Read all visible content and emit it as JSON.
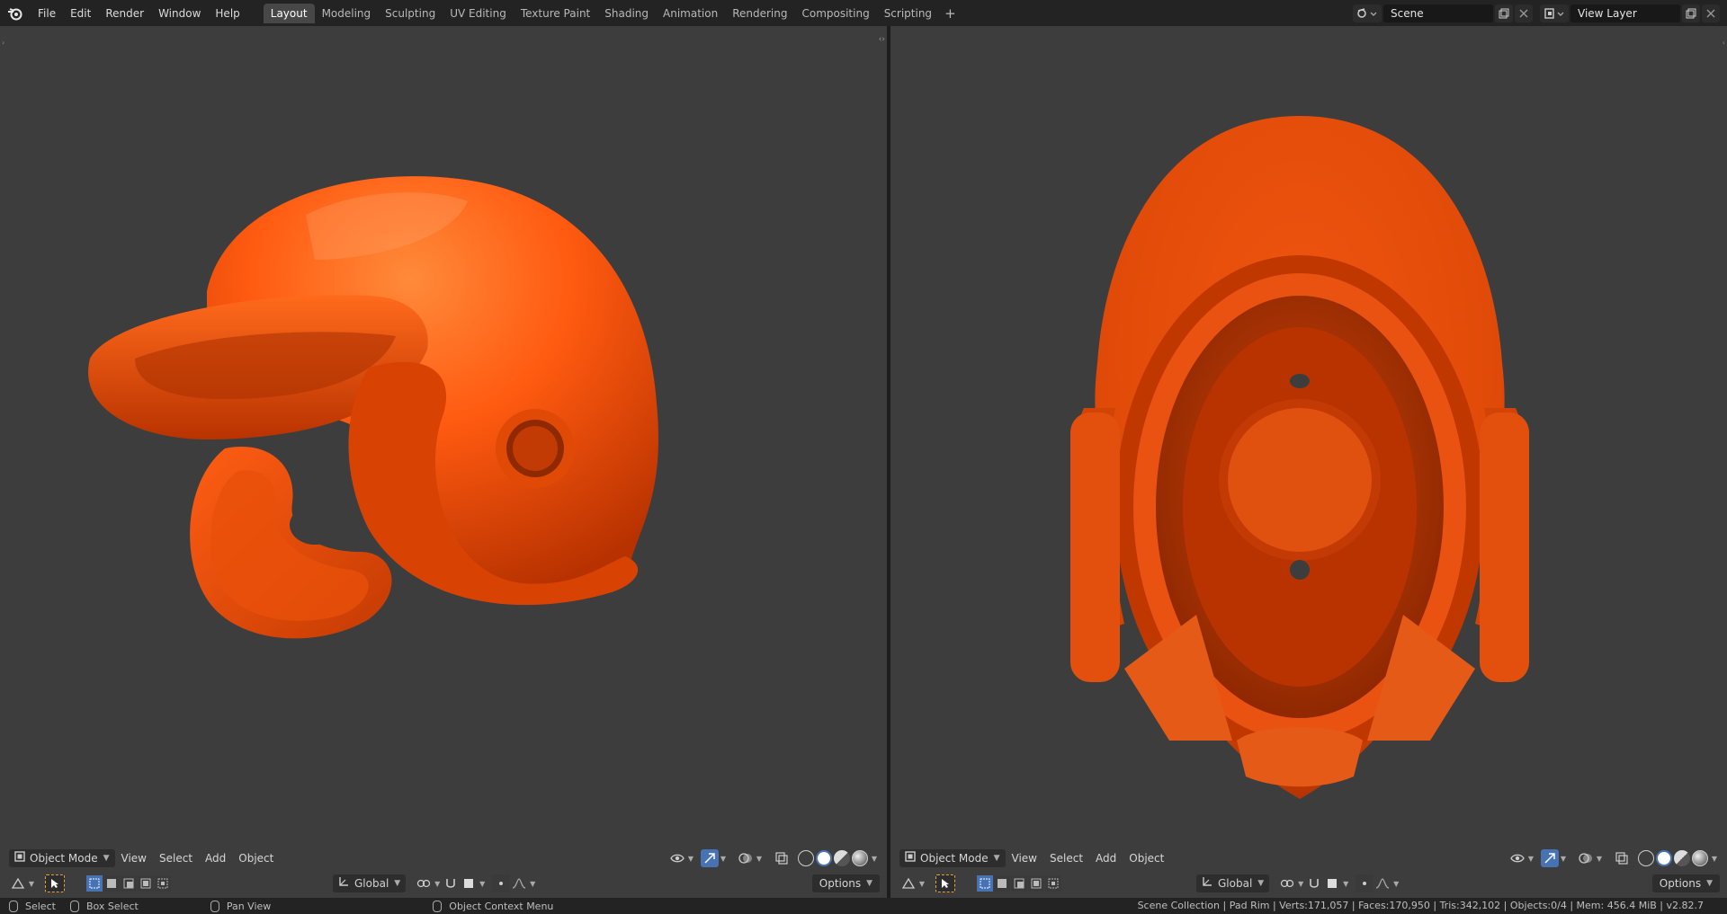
{
  "menu": [
    "File",
    "Edit",
    "Render",
    "Window",
    "Help"
  ],
  "workspaces": [
    {
      "label": "Layout",
      "active": true
    },
    {
      "label": "Modeling"
    },
    {
      "label": "Sculpting"
    },
    {
      "label": "UV Editing"
    },
    {
      "label": "Texture Paint"
    },
    {
      "label": "Shading"
    },
    {
      "label": "Animation"
    },
    {
      "label": "Rendering"
    },
    {
      "label": "Compositing"
    },
    {
      "label": "Scripting"
    }
  ],
  "scene": "Scene",
  "view_layer": "View Layer",
  "viewport_left": {
    "mode": "Object Mode",
    "menus": [
      "View",
      "Select",
      "Add",
      "Object"
    ],
    "orientation": "Global",
    "options": "Options"
  },
  "viewport_right": {
    "mode": "Object Mode",
    "menus": [
      "View",
      "Select",
      "Add",
      "Object"
    ],
    "orientation": "Global",
    "options": "Options"
  },
  "status": {
    "select": "Select",
    "box_select": "Box Select",
    "pan_view": "Pan View",
    "context_menu": "Object Context Menu",
    "stats": "Scene Collection | Pad Rim | Verts:171,057 | Faces:170,950 | Tris:342,102 | Objects:0/4 | Mem: 456.4 MiB | v2.82.7"
  },
  "colors": {
    "helmet": "#ff5a10",
    "viewport_bg": "#3d3d3d",
    "active_blue": "#4772b3"
  }
}
